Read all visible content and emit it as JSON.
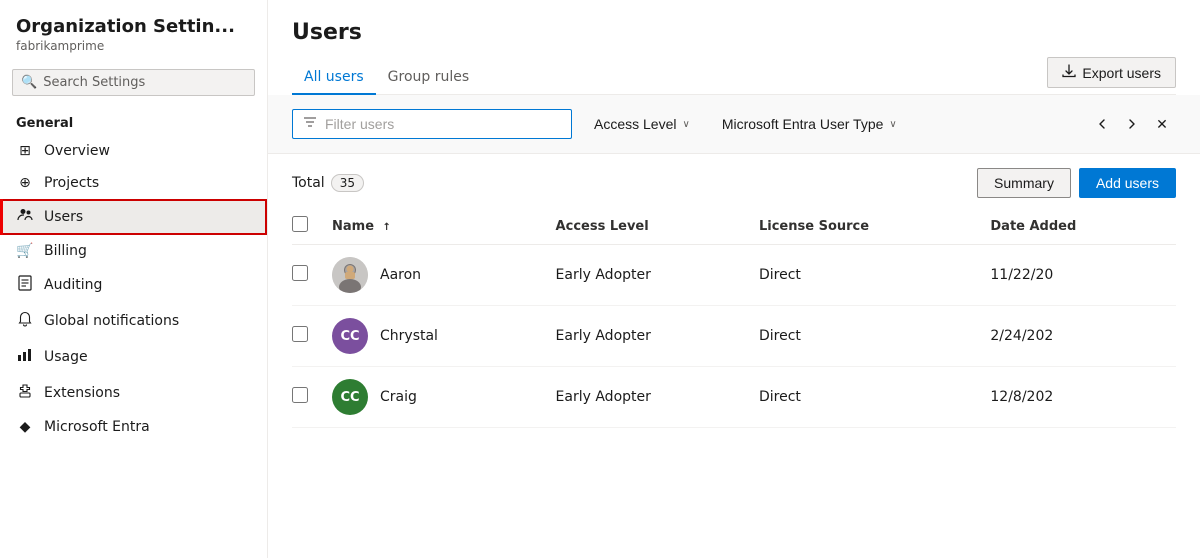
{
  "sidebar": {
    "title": "Organization Settin...",
    "subtitle": "fabrikamprime",
    "search_placeholder": "Search Settings",
    "section_general": "General",
    "nav_items": [
      {
        "id": "overview",
        "label": "Overview",
        "icon": "⊞"
      },
      {
        "id": "projects",
        "label": "Projects",
        "icon": "⊕"
      },
      {
        "id": "users",
        "label": "Users",
        "icon": "👥",
        "active": true
      },
      {
        "id": "billing",
        "label": "Billing",
        "icon": "🛒"
      },
      {
        "id": "auditing",
        "label": "Auditing",
        "icon": "📋"
      },
      {
        "id": "global-notifications",
        "label": "Global notifications",
        "icon": "🔔"
      },
      {
        "id": "usage",
        "label": "Usage",
        "icon": "📊"
      },
      {
        "id": "extensions",
        "label": "Extensions",
        "icon": "🧩"
      },
      {
        "id": "microsoft-entra",
        "label": "Microsoft Entra",
        "icon": "◆"
      }
    ]
  },
  "main": {
    "title": "Users",
    "tabs": [
      {
        "id": "all-users",
        "label": "All users",
        "active": true
      },
      {
        "id": "group-rules",
        "label": "Group rules",
        "active": false
      }
    ],
    "export_button": "Export users",
    "filter_placeholder": "Filter users",
    "access_level_label": "Access Level",
    "user_type_label": "Microsoft Entra User Type",
    "total_label": "Total",
    "total_count": "35",
    "summary_button": "Summary",
    "add_users_button": "Add users",
    "table": {
      "columns": [
        "Name",
        "Access Level",
        "License Source",
        "Date Added"
      ],
      "rows": [
        {
          "name": "Aaron",
          "access_level": "Early Adopter",
          "license_source": "Direct",
          "date_added": "11/22/20",
          "avatar_type": "image",
          "avatar_color": "#c8c6c4",
          "avatar_initials": ""
        },
        {
          "name": "Chrystal",
          "access_level": "Early Adopter",
          "license_source": "Direct",
          "date_added": "2/24/202",
          "avatar_type": "initials",
          "avatar_color": "#7b4f9e",
          "avatar_initials": "CC"
        },
        {
          "name": "Craig",
          "access_level": "Early Adopter",
          "license_source": "Direct",
          "date_added": "12/8/202",
          "avatar_type": "initials",
          "avatar_color": "#2e7d32",
          "avatar_initials": "CC"
        }
      ]
    }
  }
}
